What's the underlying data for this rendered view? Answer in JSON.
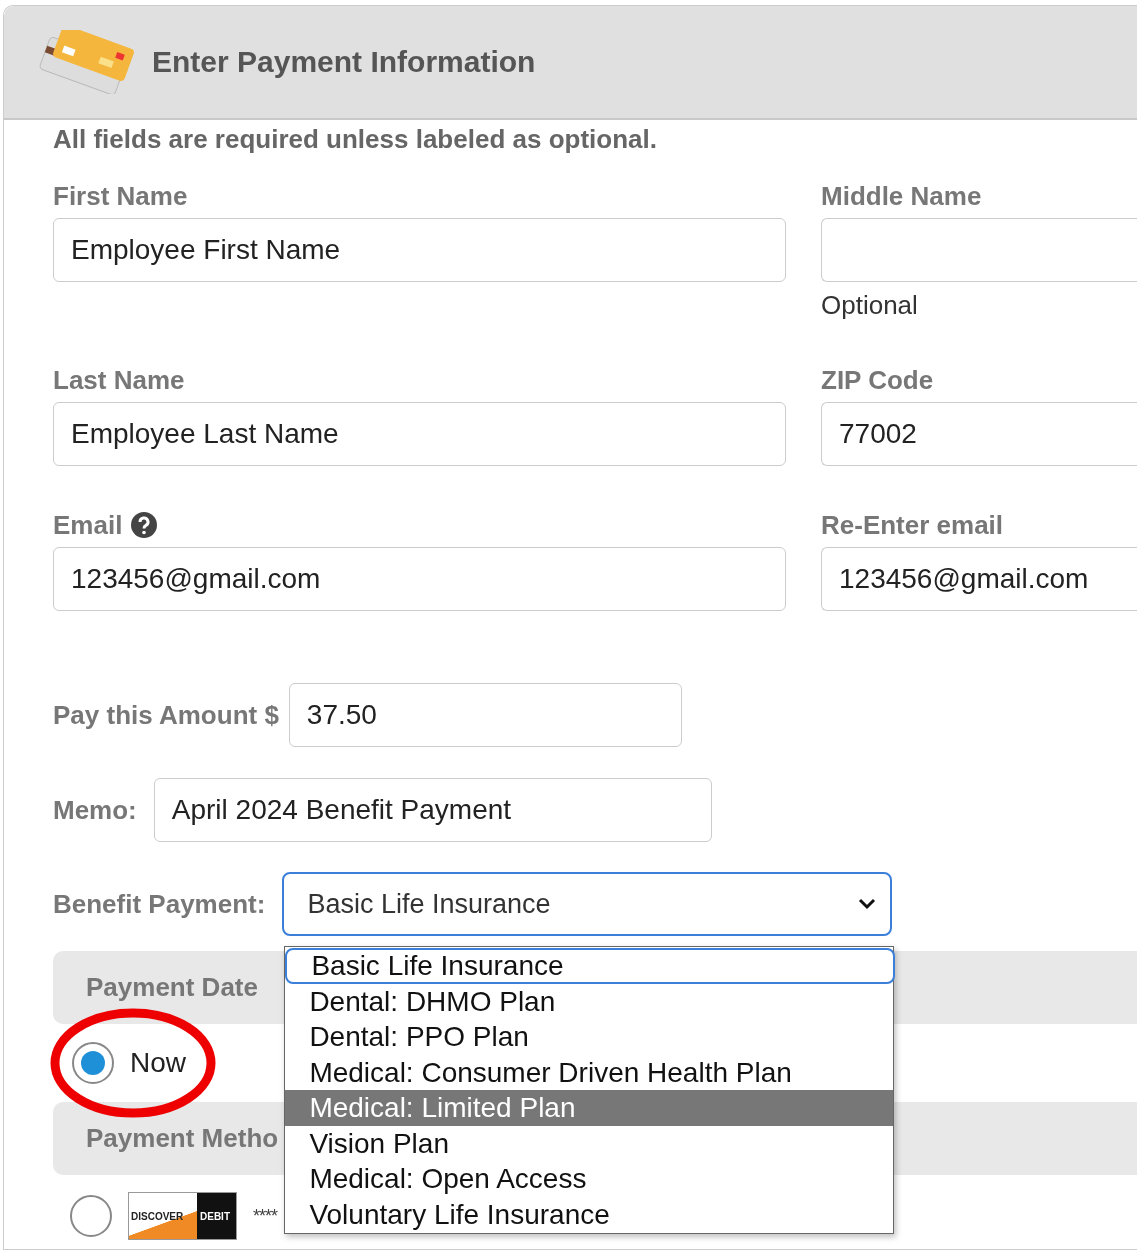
{
  "header": {
    "title": "Enter Payment Information"
  },
  "note": "All fields are required unless labeled as optional.",
  "fields": [
    {
      "label": "First Name",
      "value": "Employee First Name"
    },
    {
      "label": "Middle Name",
      "hint": "Optional"
    },
    {
      "label": "Last Name",
      "value": "Employee Last Name"
    },
    {
      "label": "ZIP Code",
      "value": "77002"
    },
    {
      "label": "Email",
      "value": "123456@gmail.com",
      "help_icon": true
    },
    {
      "label": "Re-Enter email",
      "value": "123456@gmail.com"
    }
  ],
  "amount": {
    "label": "Pay this Amount $",
    "value": "37.50"
  },
  "memo": {
    "label": "Memo:",
    "value": "April 2024 Benefit Payment"
  },
  "benefit": {
    "label": "Benefit Payment:",
    "value": "Basic Life Insurance",
    "expanded": true,
    "options": [
      {
        "label": "Basic Life Insurance",
        "selected": true,
        "highlighted": false
      },
      {
        "label": "Dental: DHMO Plan",
        "selected": false,
        "highlighted": false
      },
      {
        "label": "Dental: PPO Plan",
        "selected": false,
        "highlighted": false
      },
      {
        "label": "Medical: Consumer Driven Health Plan",
        "selected": false,
        "highlighted": false
      },
      {
        "label": "Medical: Limited Plan",
        "selected": false,
        "highlighted": true
      },
      {
        "label": "Vision Plan",
        "selected": false,
        "highlighted": false
      },
      {
        "label": "Medical: Open Access",
        "selected": false,
        "highlighted": false
      },
      {
        "label": "Voluntary Life Insurance",
        "selected": false,
        "highlighted": false
      }
    ]
  },
  "payment_date": {
    "title": "Payment Date",
    "options": [
      {
        "label": "Now",
        "selected": true
      }
    ]
  },
  "payment_method": {
    "title": "Payment Metho",
    "options": [
      {
        "card_brand": "DISCOVER",
        "card_type": "DEBIT",
        "number": "****",
        "selected": false
      }
    ]
  },
  "annotation": {
    "kind": "ellipse"
  }
}
